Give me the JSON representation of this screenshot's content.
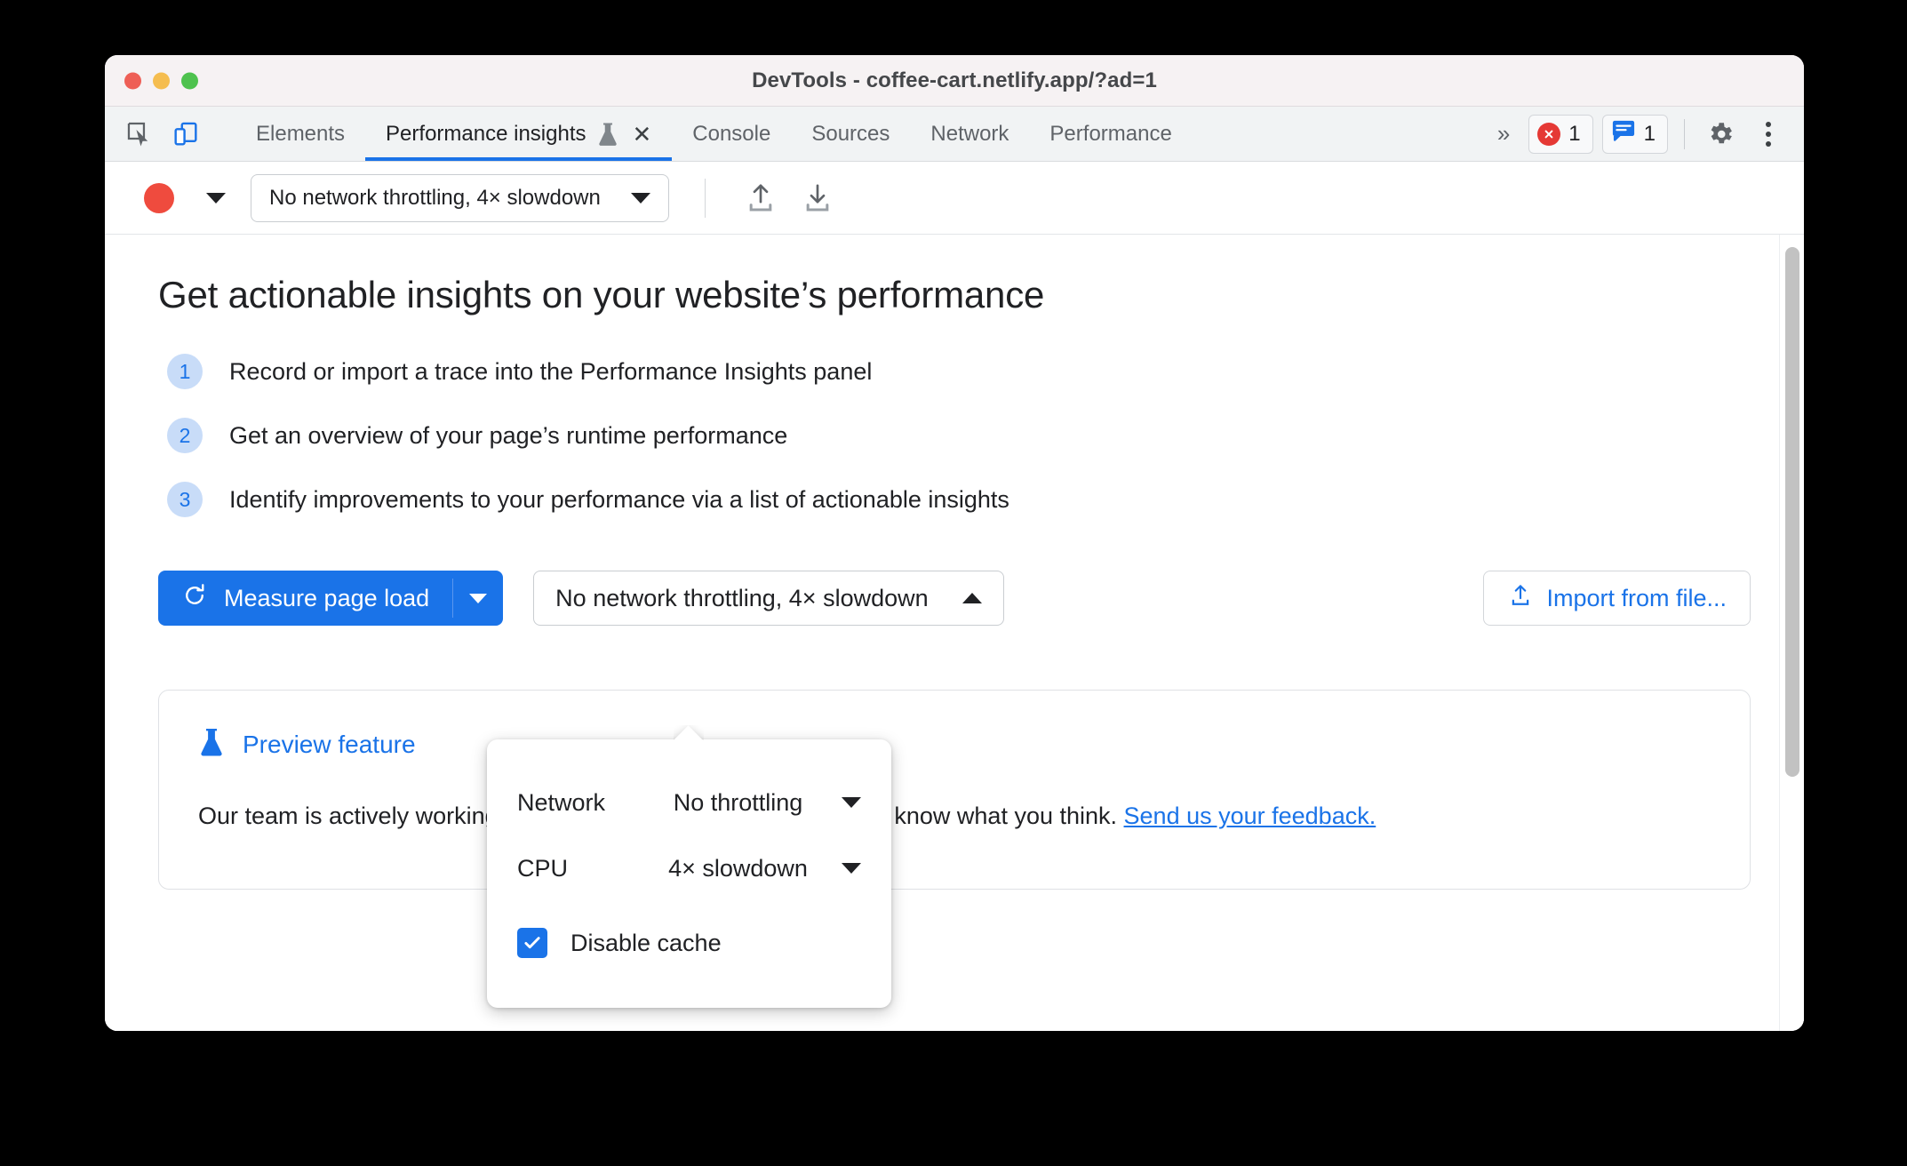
{
  "window": {
    "title": "DevTools - coffee-cart.netlify.app/?ad=1",
    "traffic_lights": [
      "close",
      "minimize",
      "zoom"
    ]
  },
  "tabbar": {
    "inspect_icon": "inspect-element-icon",
    "device_icon": "device-toolbar-icon",
    "tabs": [
      {
        "label": "Elements",
        "active": false
      },
      {
        "label": "Performance insights",
        "active": true,
        "has_flask": true,
        "closable": true
      },
      {
        "label": "Console",
        "active": false
      },
      {
        "label": "Sources",
        "active": false
      },
      {
        "label": "Network",
        "active": false
      },
      {
        "label": "Performance",
        "active": false
      }
    ],
    "more_tabs": "»",
    "error_count": "1",
    "issue_count": "1",
    "settings_icon": "gear-icon",
    "more_options_icon": "kebab-menu-icon"
  },
  "toolbar": {
    "record_label": "record-button",
    "record_color": "#ef4b3e",
    "throttling_value": "No network throttling, 4× slowdown",
    "upload_icon": "upload-icon",
    "download_icon": "download-icon"
  },
  "main": {
    "headline": "Get actionable insights on your website’s performance",
    "steps": [
      {
        "num": "1",
        "text": "Record or import a trace into the Performance Insights panel"
      },
      {
        "num": "2",
        "text": "Get an overview of your page’s runtime performance"
      },
      {
        "num": "3",
        "text": "Identify improvements to your performance via a list of actionable insights"
      }
    ],
    "measure_button": "Measure page load",
    "throttling_button": "No network throttling, 4× slowdown",
    "import_button": "Import from file...",
    "preview_card": {
      "title": "Preview feature",
      "body_before": "Our team is actively working on this feature and we would love to know what you think. ",
      "link": "Send us your feedback."
    }
  },
  "popup": {
    "rows": [
      {
        "label": "Network",
        "value": "No throttling"
      },
      {
        "label": "CPU",
        "value": "4× slowdown"
      }
    ],
    "checkbox": {
      "label": "Disable cache",
      "checked": true
    }
  },
  "colors": {
    "accent_blue": "#1a73e8",
    "record_red": "#ef4b3e",
    "error_red": "#e53935",
    "step_badge_bg": "#c8dcf8"
  }
}
